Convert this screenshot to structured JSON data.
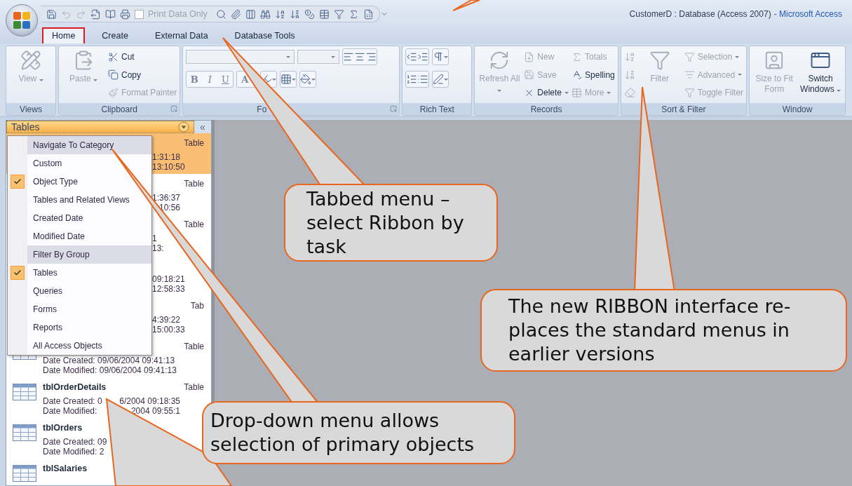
{
  "window": {
    "title": "CustomerD : Database (Access 2007)",
    "app_name": "- Microsoft Access"
  },
  "quick_access": {
    "checkbox": {
      "label": "Print Data Only",
      "checked": false
    }
  },
  "tabs": [
    {
      "label": "Home",
      "selected": true
    },
    {
      "label": "Create",
      "selected": false
    },
    {
      "label": "External Data",
      "selected": false
    },
    {
      "label": "Database Tools",
      "selected": false
    }
  ],
  "ribbon": {
    "groups": [
      {
        "kind": "buttons",
        "label": "Views",
        "launcher": false,
        "columns": [
          [
            {
              "kind": "large",
              "label": "View",
              "disabled": true,
              "dropdown": true
            }
          ]
        ]
      },
      {
        "kind": "buttons",
        "label": "Clipboard",
        "launcher": true,
        "columns": [
          [
            {
              "kind": "large",
              "label": "Paste",
              "disabled": true,
              "dropdown": true
            }
          ],
          [
            {
              "kind": "small",
              "label": "Cut",
              "disabled": false,
              "dropdown": false
            },
            {
              "kind": "small",
              "label": "Copy",
              "disabled": false,
              "dropdown": false
            },
            {
              "kind": "small",
              "label": "Format Painter",
              "disabled": true,
              "dropdown": false
            }
          ]
        ]
      },
      {
        "kind": "font",
        "label": "Fo",
        "launcher": true,
        "format_buttons": [
          "B",
          "I",
          "U",
          "A"
        ]
      },
      {
        "kind": "icons",
        "label": "Rich Text",
        "launcher": false
      },
      {
        "kind": "buttons",
        "label": "Records",
        "launcher": false,
        "columns": [
          [
            {
              "kind": "large",
              "label": "Refresh All",
              "disabled": true,
              "dropdown": true
            }
          ],
          [
            {
              "kind": "small",
              "label": "New",
              "disabled": true,
              "dropdown": false
            },
            {
              "kind": "small",
              "label": "Save",
              "disabled": true,
              "dropdown": false
            },
            {
              "kind": "small",
              "label": "Delete",
              "disabled": false,
              "dropdown": true
            }
          ],
          [
            {
              "kind": "small",
              "label": "Totals",
              "disabled": true,
              "dropdown": false
            },
            {
              "kind": "small",
              "label": "Spelling",
              "disabled": false,
              "dropdown": false
            },
            {
              "kind": "small",
              "label": "More",
              "disabled": true,
              "dropdown": true
            }
          ]
        ]
      },
      {
        "kind": "buttons",
        "label": "Sort & Filter",
        "launcher": false,
        "columns": [
          [
            {
              "kind": "icon",
              "disabled": true
            },
            {
              "kind": "icon",
              "disabled": true
            },
            {
              "kind": "icon",
              "disabled": true
            }
          ],
          [
            {
              "kind": "large",
              "label": "Filter",
              "disabled": true,
              "dropdown": false
            }
          ],
          [
            {
              "kind": "small",
              "label": "Selection",
              "disabled": true,
              "dropdown": true
            },
            {
              "kind": "small",
              "label": "Advanced",
              "disabled": true,
              "dropdown": true
            },
            {
              "kind": "small",
              "label": "Toggle Filter",
              "disabled": true,
              "dropdown": false
            }
          ]
        ]
      },
      {
        "kind": "buttons",
        "label": "Window",
        "launcher": false,
        "columns": [
          [
            {
              "kind": "large",
              "label": "Size to Fit Form",
              "disabled": true,
              "dropdown": false
            }
          ],
          [
            {
              "kind": "large",
              "label": "Switch Windows",
              "disabled": false,
              "dropdown": true
            }
          ]
        ]
      }
    ]
  },
  "navigation": {
    "title": "Tables",
    "collapse": "«",
    "rows": [
      {
        "kind": "covered",
        "type": "Table",
        "selected": true,
        "lines": [
          {
            "text": "1:31:18"
          },
          {
            "text": "13:10:50"
          }
        ]
      },
      {
        "kind": "covered",
        "type": "Table",
        "selected": false,
        "lines": [
          {
            "text": "1:36:37"
          },
          {
            "tail": "10:56"
          }
        ]
      },
      {
        "kind": "covered",
        "type": "Table",
        "selected": false,
        "lines": [
          {
            "text": "1"
          },
          {
            "text": "13:"
          }
        ]
      },
      {
        "kind": "covered",
        "selected": false,
        "lines": [
          {
            "text": "09:18:21"
          },
          {
            "text": "12:58:33"
          }
        ]
      },
      {
        "kind": "covered",
        "type": "Tab",
        "selected": false,
        "lines": [
          {
            "text": "4:39:22"
          },
          {
            "text": "15:00:33"
          }
        ]
      },
      {
        "kind": "full",
        "type": "Table",
        "selected": false,
        "lines": [
          {
            "text": "Date Created: 09/06/2004 09:41:13"
          },
          {
            "text": "Date Modified: 09/06/2004 09:41:13"
          }
        ]
      },
      {
        "kind": "full",
        "name": "tblOrderDetails",
        "type": "Table",
        "selected": false,
        "lines": [
          {
            "text": "Date Created: 0",
            "tail": "6/2004 09:18:35"
          },
          {
            "text": "Date Modified:",
            "tail": "2004 09:55:1"
          }
        ]
      },
      {
        "kind": "full",
        "name": "tblOrders",
        "selected": false,
        "lines": [
          {
            "text": "Date Created: 09"
          },
          {
            "text": "Date Modified: 2"
          }
        ]
      },
      {
        "kind": "full",
        "name": "tblSalaries",
        "selected": false,
        "lines": []
      }
    ]
  },
  "menu": {
    "items": [
      {
        "kind": "header",
        "label": "Navigate To Category"
      },
      {
        "kind": "option",
        "label": "Custom",
        "checked": false
      },
      {
        "kind": "option",
        "label": "Object Type",
        "checked": true
      },
      {
        "kind": "option",
        "label": "Tables and Related Views",
        "checked": false
      },
      {
        "kind": "option",
        "label": "Created Date",
        "checked": false
      },
      {
        "kind": "option",
        "label": "Modified Date",
        "checked": false
      },
      {
        "kind": "header",
        "label": "Filter By Group"
      },
      {
        "kind": "option",
        "label": "Tables",
        "checked": true
      },
      {
        "kind": "option",
        "label": "Queries",
        "checked": false
      },
      {
        "kind": "option",
        "label": "Forms",
        "checked": false
      },
      {
        "kind": "option",
        "label": "Reports",
        "checked": false
      },
      {
        "kind": "option",
        "label": "All Access Objects",
        "checked": false
      }
    ]
  },
  "callouts": [
    {
      "text": "Tabbed menu – select Ribbon by task"
    },
    {
      "text": "The new RIBBON interface re-places the standard menus in earlier versions"
    },
    {
      "text": "Drop-down menu allows selection of primary objects"
    }
  ]
}
